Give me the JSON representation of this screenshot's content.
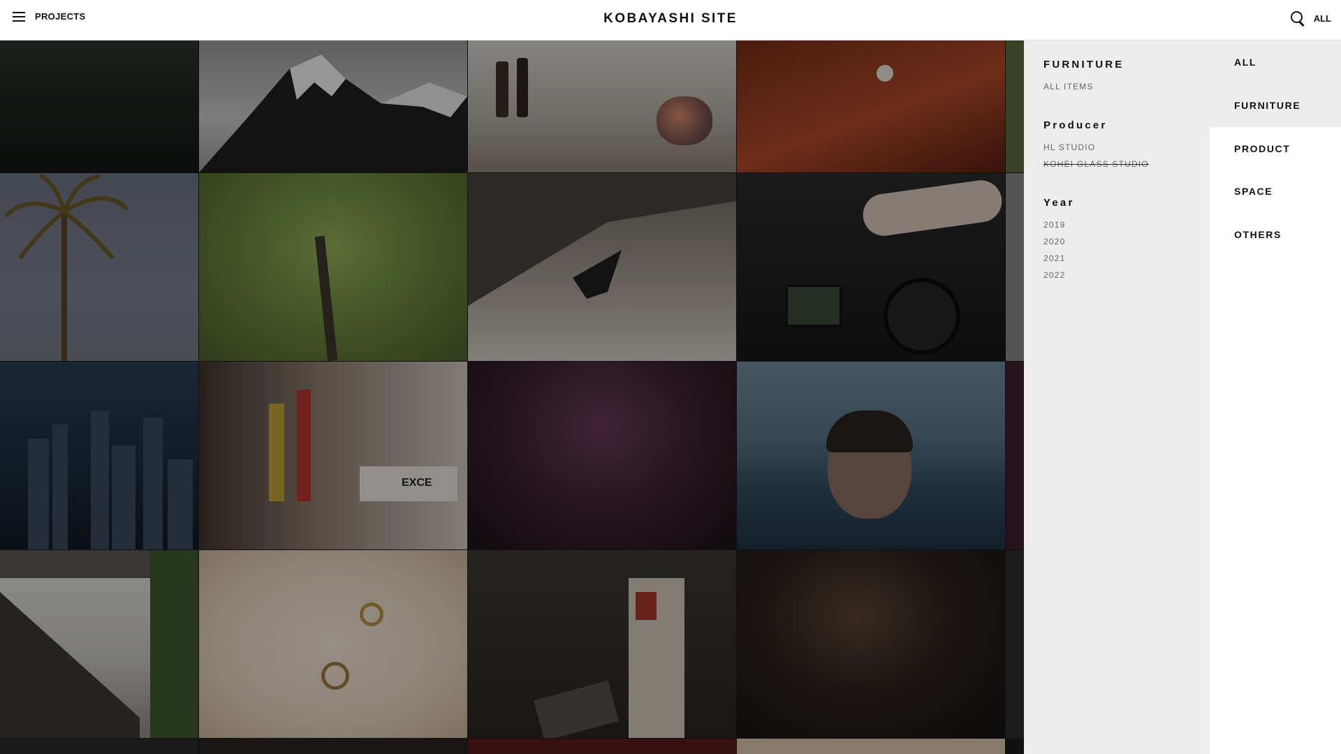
{
  "header": {
    "menu_label": "PROJECTS",
    "site_title": "KOBAYASHI SITE",
    "current_filter": "ALL"
  },
  "filters": {
    "category_group": {
      "heading": "FURNITURE",
      "items": [
        "ALL ITEMS"
      ]
    },
    "producer_group": {
      "heading": "Producer",
      "items": [
        "HL STUDIO",
        "KOHEI GLASS STUDIO"
      ]
    },
    "year_group": {
      "heading": "Year",
      "items": [
        "2019",
        "2020",
        "2021",
        "2022"
      ]
    }
  },
  "categories": [
    "ALL",
    "FURNITURE",
    "PRODUCT",
    "SPACE",
    "OTHERS"
  ],
  "gallery": {
    "tiles": [
      "dark-forest-hill",
      "snowy-mountain",
      "wine-bottles-flowers",
      "red-leather-chair",
      "palm-tree",
      "green-willow-tree",
      "person-on-concrete-wall",
      "dj-mixer",
      "city-skyline-night",
      "tokyo-street-signs",
      "purple-flowers",
      "woman-in-water",
      "building-stairs-moss",
      "rings-on-stone",
      "shibuya-aerial",
      "man-in-shadow"
    ]
  },
  "colors": {
    "panel_bg": "#ededed",
    "accent_text": "#111111"
  }
}
